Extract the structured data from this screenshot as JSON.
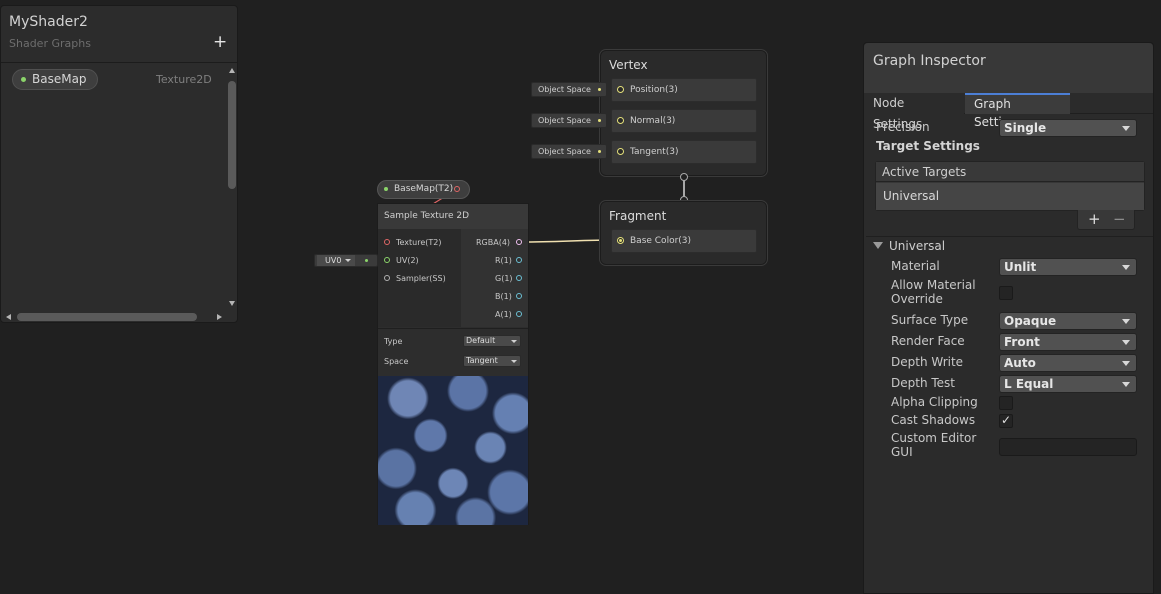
{
  "blackboard": {
    "title": "MyShader2",
    "subtitle": "Shader Graphs",
    "add_icon": "plus-icon",
    "property": {
      "name": "BaseMap",
      "type": "Texture2D"
    }
  },
  "nodes": {
    "vertex": {
      "title": "Vertex",
      "slots": [
        "Position(3)",
        "Normal(3)",
        "Tangent(3)"
      ],
      "space_tags": [
        "Object Space",
        "Object Space",
        "Object Space"
      ]
    },
    "fragment": {
      "title": "Fragment",
      "slots": [
        "Base Color(3)"
      ]
    },
    "basemap_property": {
      "label": "BaseMap(T2)"
    },
    "sample_texture": {
      "title": "Sample Texture 2D",
      "inputs": [
        "Texture(T2)",
        "UV(2)",
        "Sampler(SS)"
      ],
      "outputs": [
        "RGBA(4)",
        "R(1)",
        "G(1)",
        "B(1)",
        "A(1)"
      ],
      "type_label": "Type",
      "type_value": "Default",
      "space_label": "Space",
      "space_value": "Tangent"
    },
    "uv": {
      "value": "UV0"
    }
  },
  "wire_colors": {
    "texture": "#e06666",
    "vector3": "#e4e07a",
    "vector2": "#8bd46a",
    "vector4": "#f0c0f0",
    "stack": "#a8a8a8"
  },
  "inspector": {
    "title": "Graph Inspector",
    "tabs": [
      "Node Settings",
      "Graph Settings"
    ],
    "active_tab": "Graph Settings",
    "precision_label": "Precision",
    "precision_value": "Single",
    "target_settings_label": "Target Settings",
    "active_targets_label": "Active Targets",
    "active_targets": [
      "Universal"
    ],
    "add_icon": "plus-icon",
    "remove_icon": "minus-icon",
    "universal_section": "Universal",
    "settings": [
      {
        "label": "Material",
        "kind": "dropdown",
        "value": "Unlit"
      },
      {
        "label": "Allow Material Override",
        "kind": "checkbox",
        "checked": false
      },
      {
        "label": "Surface Type",
        "kind": "dropdown",
        "value": "Opaque"
      },
      {
        "label": "Render Face",
        "kind": "dropdown",
        "value": "Front"
      },
      {
        "label": "Depth Write",
        "kind": "dropdown",
        "value": "Auto"
      },
      {
        "label": "Depth Test",
        "kind": "dropdown",
        "value": "L Equal"
      },
      {
        "label": "Alpha Clipping",
        "kind": "checkbox",
        "checked": false
      },
      {
        "label": "Cast Shadows",
        "kind": "checkbox",
        "checked": true
      },
      {
        "label": "Custom Editor GUI",
        "kind": "text",
        "value": ""
      }
    ]
  }
}
